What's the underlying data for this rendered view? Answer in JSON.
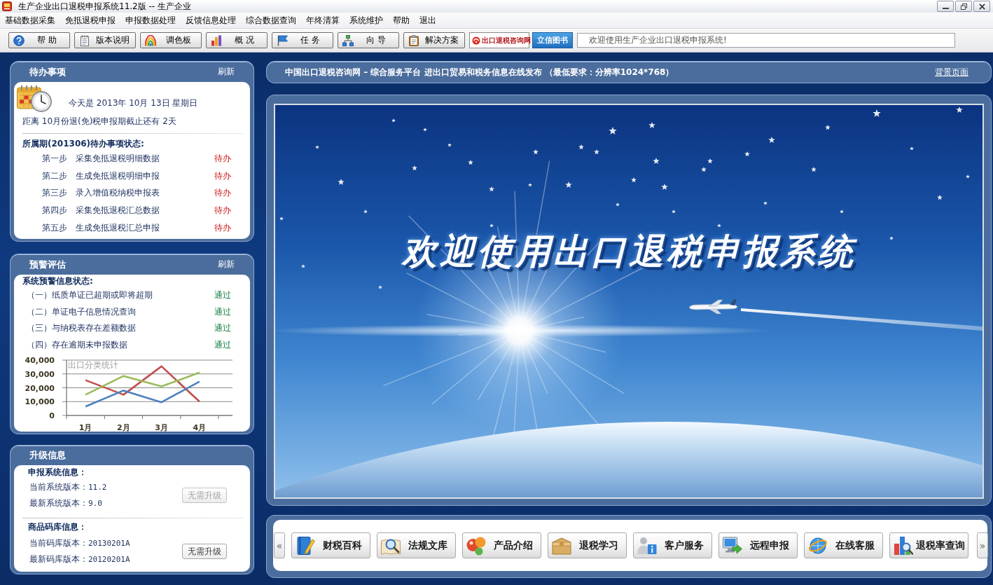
{
  "window": {
    "title": "生产企业出口退税申报系统11.2版 -- 生产企业"
  },
  "menu": [
    "基础数据采集",
    "免抵退税申报",
    "申报数据处理",
    "反馈信息处理",
    "综合数据查询",
    "年终清算",
    "系统维护",
    "帮助",
    "退出"
  ],
  "toolbar": {
    "buttons": [
      {
        "label": "帮 助",
        "kind": "help"
      },
      {
        "label": "版本说明",
        "kind": "notes"
      },
      {
        "label": "调色板",
        "kind": "palette"
      },
      {
        "label": "概 况",
        "kind": "chart"
      },
      {
        "label": "任 务",
        "kind": "flag"
      },
      {
        "label": "向 导",
        "kind": "tree"
      },
      {
        "label": "解决方案",
        "kind": "clipboard"
      }
    ],
    "logos": [
      {
        "text": "出口退税咨询网",
        "kind": "consult"
      },
      {
        "text": "立信图书",
        "kind": "books"
      }
    ],
    "welcome": "欢迎使用生产企业出口退税申报系统!"
  },
  "todo": {
    "title": "待办事项",
    "refresh": "刷新",
    "today": "今天是 2013年 10月 13日 星期日",
    "deadline": "距离 10月份退(免)税申报期截止还有 2天",
    "heading": "所属期(201306)待办事项状态:",
    "steps": [
      {
        "step": "第一步",
        "task": "采集免抵退税明细数据",
        "status": "待办",
        "done": false
      },
      {
        "step": "第二步",
        "task": "生成免抵退税明细申报",
        "status": "待办",
        "done": false
      },
      {
        "step": "第三步",
        "task": "录入增值税纳税申报表",
        "status": "待办",
        "done": false
      },
      {
        "step": "第四步",
        "task": "采集免抵退税汇总数据",
        "status": "待办",
        "done": false
      },
      {
        "step": "第五步",
        "task": "生成免抵退税汇总申报",
        "status": "待办",
        "done": false
      }
    ]
  },
  "warning": {
    "title": "预警评估",
    "refresh": "刷新",
    "heading": "系统预警信息状态:",
    "items": [
      {
        "text": "（一）纸质单证已超期或即将超期",
        "status": "通过",
        "passed": true
      },
      {
        "text": "（二）单证电子信息情况查询",
        "status": "通过",
        "passed": true
      },
      {
        "text": "（三）与纳税表存在差额数据",
        "status": "通过",
        "passed": true
      },
      {
        "text": "（四）存在逾期未申报数据",
        "status": "通过",
        "passed": true
      }
    ],
    "chart_data": {
      "type": "line",
      "title": "出口分类统计",
      "categories": [
        "1月",
        "2月",
        "3月",
        "4月"
      ],
      "series": [
        {
          "color": "#c0504d",
          "values": [
            25500,
            15000,
            35500,
            10000
          ]
        },
        {
          "color": "#9bbb59",
          "values": [
            15000,
            28500,
            21000,
            31000
          ]
        },
        {
          "color": "#4f81bd",
          "values": [
            6500,
            18000,
            9500,
            24500
          ]
        }
      ],
      "ylim": [
        0,
        40000
      ],
      "yticks": [
        {
          "value": 0,
          "label": "0"
        },
        {
          "value": 10000,
          "label": "10,000"
        },
        {
          "value": 20000,
          "label": "20,000"
        },
        {
          "value": 30000,
          "label": "30,000"
        },
        {
          "value": 40000,
          "label": "40,000"
        }
      ],
      "grid": true
    }
  },
  "upgrade": {
    "title": "升级信息",
    "sections": [
      {
        "heading": "申报系统信息：",
        "rows": [
          {
            "label": "当前系统版本：",
            "value": "11.2"
          },
          {
            "label": "最新系统版本：",
            "value": "9.0"
          }
        ],
        "button": {
          "label": "无需升级",
          "disabled": true
        }
      },
      {
        "heading": "商品码库信息：",
        "rows": [
          {
            "label": "当前码库版本：",
            "value": "20130201A"
          },
          {
            "label": "最新码库版本：",
            "value": "20120201A"
          }
        ],
        "button": {
          "label": "无需升级",
          "disabled": false
        }
      }
    ]
  },
  "info_bar": {
    "text": "中国出口退税咨询网 – 综合服务平台 进出口贸易和税务信息在线发布 （最低要求：分辨率1024*768）",
    "link": "背景页面"
  },
  "splash": {
    "headline": "欢迎使用出口退税申报系统"
  },
  "quick_links": {
    "prev": "«",
    "next": "»",
    "buttons": [
      {
        "label": "财税百科",
        "kind": "book"
      },
      {
        "label": "法规文库",
        "kind": "search"
      },
      {
        "label": "产品介绍",
        "kind": "bubbles"
      },
      {
        "label": "退税学习",
        "kind": "box"
      },
      {
        "label": "客户服务",
        "kind": "info"
      },
      {
        "label": "远程申报",
        "kind": "monitor"
      },
      {
        "label": "在线客服",
        "kind": "globe"
      },
      {
        "label": "退税率查询",
        "kind": "rate"
      }
    ]
  }
}
